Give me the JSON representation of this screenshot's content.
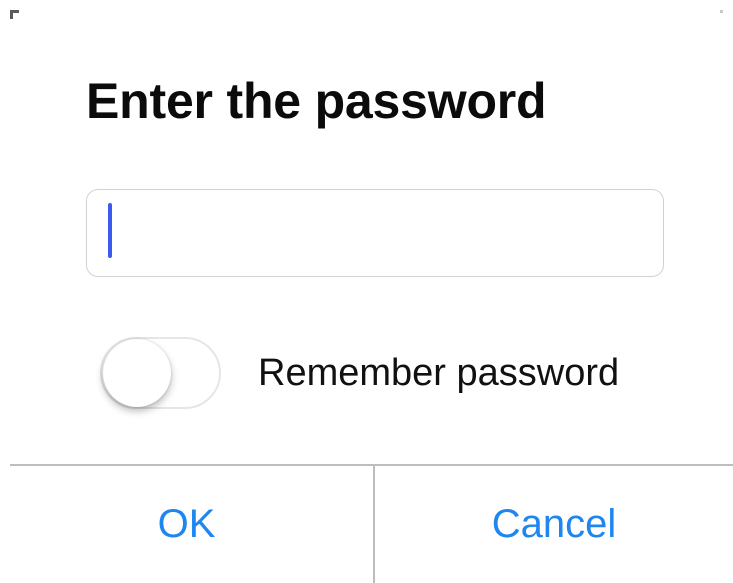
{
  "dialog": {
    "title": "Enter the password",
    "password_field": {
      "value": "",
      "placeholder": ""
    },
    "remember_toggle": {
      "label": "Remember password",
      "checked": false
    },
    "buttons": {
      "ok_label": "OK",
      "cancel_label": "Cancel"
    }
  },
  "colors": {
    "accent": "#1f86f0",
    "caret": "#3b5bf0",
    "title_text": "#0b0b0b",
    "divider": "#bdbdbd",
    "field_border": "#d2d2d2"
  }
}
